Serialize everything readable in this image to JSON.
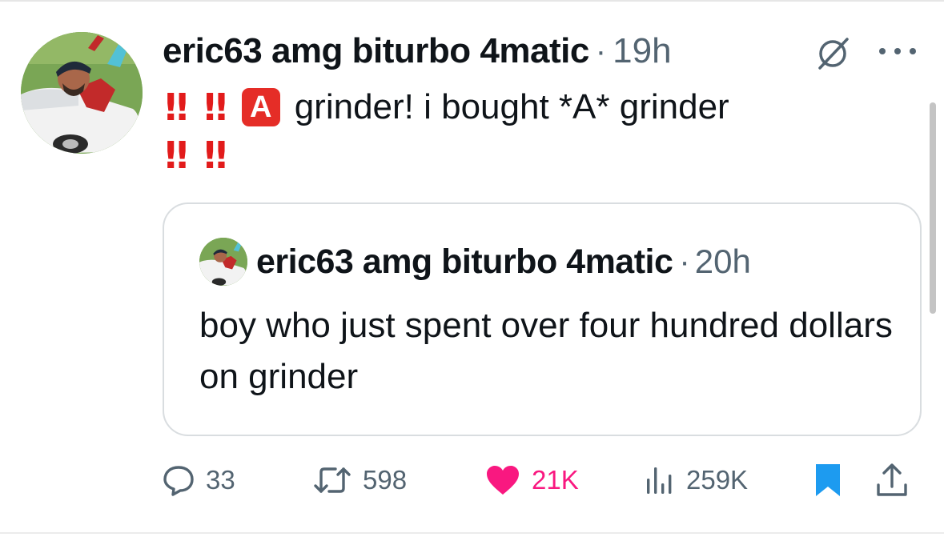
{
  "tweet": {
    "author_name": "eric63 amg biturbo 4matic",
    "separator": "·",
    "time": "19h",
    "avatar_icon": "profile-photo-person-on-car",
    "line1_marks": "‼ ‼",
    "letter_emoji": "A",
    "line1_text": "grinder! i bought *A* grinder",
    "line2_marks": "‼ ‼"
  },
  "quote": {
    "author_name": "eric63 amg biturbo 4matic",
    "separator": "·",
    "time": "20h",
    "text": "boy who just spent over four hundred dollars on grinder"
  },
  "actions": {
    "replies": "33",
    "reposts": "598",
    "likes": "21K",
    "views": "259K"
  },
  "icons": {
    "grok": "grok-icon",
    "more": "more-icon",
    "reply": "reply-icon",
    "repost": "repost-icon",
    "like": "heart-icon",
    "views": "views-chart-icon",
    "bookmark": "bookmark-icon",
    "share": "share-icon"
  },
  "colors": {
    "text": "#0f1419",
    "secondary": "#536471",
    "like": "#f91880",
    "bookmark": "#1d9bf0",
    "emoji_red": "#e21b1b",
    "border": "#d9dde0"
  }
}
